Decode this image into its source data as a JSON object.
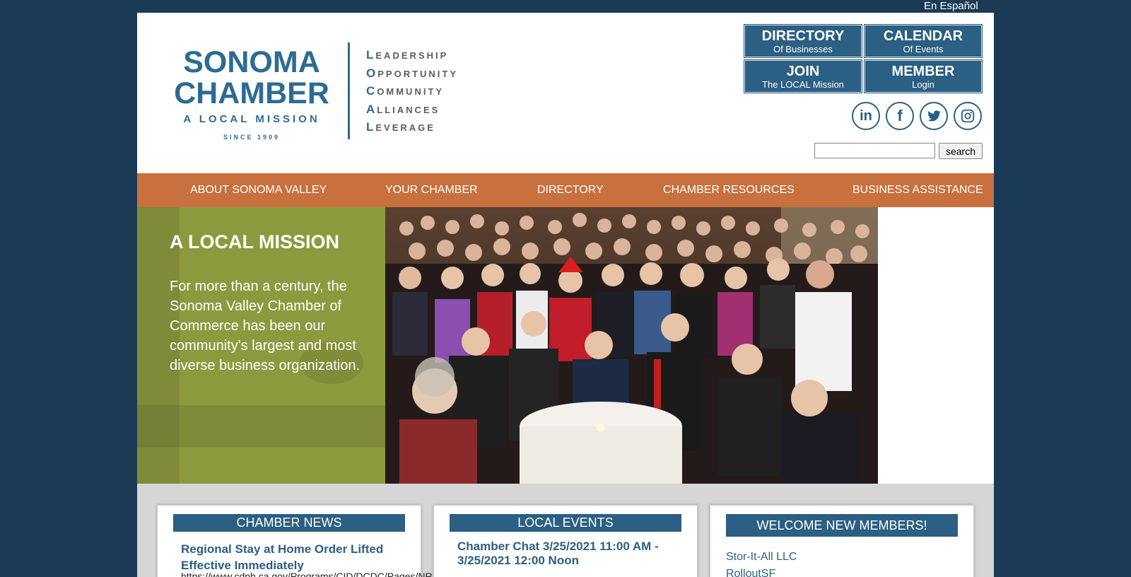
{
  "top": {
    "language_link": "En Español"
  },
  "logo": {
    "line1": "SONOMA",
    "line2": "CHAMBER",
    "tagline": "A LOCAL MISSION",
    "since": "SINCE 1909",
    "acrostic": [
      {
        "first": "L",
        "rest": "EADERSHIP"
      },
      {
        "first": "O",
        "rest": "PPORTUNITY"
      },
      {
        "first": "C",
        "rest": "OMMUNITY"
      },
      {
        "first": "A",
        "rest": "LLIANCES"
      },
      {
        "first": "L",
        "rest": "EVERAGE"
      }
    ]
  },
  "quick_links": [
    {
      "title": "DIRECTORY",
      "subtitle": "Of Businesses"
    },
    {
      "title": "CALENDAR",
      "subtitle": "Of Events"
    },
    {
      "title": "JOIN",
      "subtitle": "The LOCAL Mission"
    },
    {
      "title": "MEMBER",
      "subtitle": "Login"
    }
  ],
  "social": [
    {
      "icon": "linkedin-icon",
      "glyph": "in"
    },
    {
      "icon": "facebook-icon",
      "glyph": "f"
    },
    {
      "icon": "twitter-icon",
      "glyph": ""
    },
    {
      "icon": "instagram-icon",
      "glyph": ""
    }
  ],
  "search": {
    "value": "",
    "button_label": "search"
  },
  "nav": [
    "ABOUT SONOMA VALLEY",
    "YOUR CHAMBER",
    "DIRECTORY",
    "CHAMBER RESOURCES",
    "BUSINESS ASSISTANCE"
  ],
  "hero": {
    "title": "A LOCAL MISSION",
    "text": "For more than a century, the Sonoma Valley Chamber of Commerce has been our community's largest and most diverse business organization."
  },
  "cards": {
    "news": {
      "heading": "CHAMBER NEWS",
      "item_title": "Regional Stay at Home Order Lifted Effective Immediately",
      "item_url": "https://www.cdph.ca.gov/Programs/CID/DCDC/Pages/NR"
    },
    "events": {
      "heading": "LOCAL EVENTS",
      "item_title": "Chamber Chat 3/25/2021 11:00 AM - 3/25/2021 12:00 Noon"
    },
    "members": {
      "heading": "WELCOME NEW MEMBERS!",
      "items": [
        "Stor-It-All LLC",
        "RolloutSF"
      ]
    }
  },
  "colors": {
    "page_bg": "#1b3a55",
    "brand_blue": "#2b5f83",
    "nav_orange": "#c8703e",
    "hero_olive": "#8c9a3e"
  }
}
